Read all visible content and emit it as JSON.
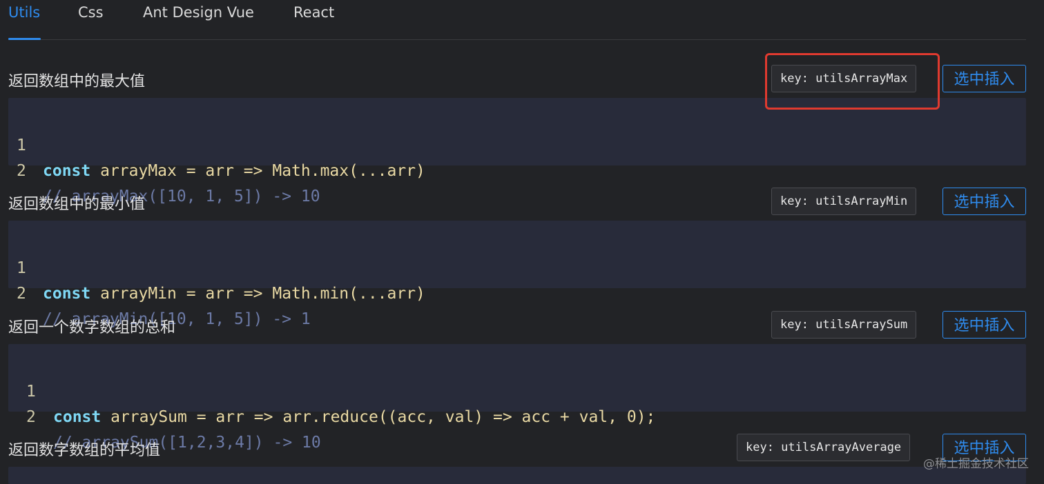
{
  "tabs": [
    "Utils",
    "Css",
    "Ant Design Vue",
    "React"
  ],
  "insert_label": "选中插入",
  "sections": [
    {
      "title": "返回数组中的最大值",
      "key": "key: utilsArrayMax",
      "lines": [
        {
          "num": "1",
          "kw": "const",
          "rest": " arrayMax = arr => Math.max(...arr)"
        },
        {
          "num": "2",
          "comment": "// arrayMax([10, 1, 5]) -> 10"
        }
      ]
    },
    {
      "title": "返回数组中的最小值",
      "key": "key: utilsArrayMin",
      "lines": [
        {
          "num": "1",
          "kw": "const",
          "rest": " arrayMin = arr => Math.min(...arr)"
        },
        {
          "num": "2",
          "comment": "// arrayMin([10, 1, 5]) -> 1"
        }
      ]
    },
    {
      "title": "返回一个数字数组的总和",
      "key": "key: utilsArraySum",
      "lines": [
        {
          "num": "1",
          "kw": "const",
          "rest": " arraySum = arr => arr.reduce((acc, val) => acc + val, 0);"
        },
        {
          "num": "2",
          "comment": "// arraySum([1,2,3,4]) -> 10"
        }
      ]
    },
    {
      "title": "返回数字数组的平均值",
      "key": "key: utilsArrayAverage",
      "lines": []
    }
  ],
  "watermark": "@稀土掘金技术社区",
  "colors": {
    "accent": "#2f8cef",
    "highlight": "#e03a2f",
    "code_bg": "#282b3a"
  }
}
